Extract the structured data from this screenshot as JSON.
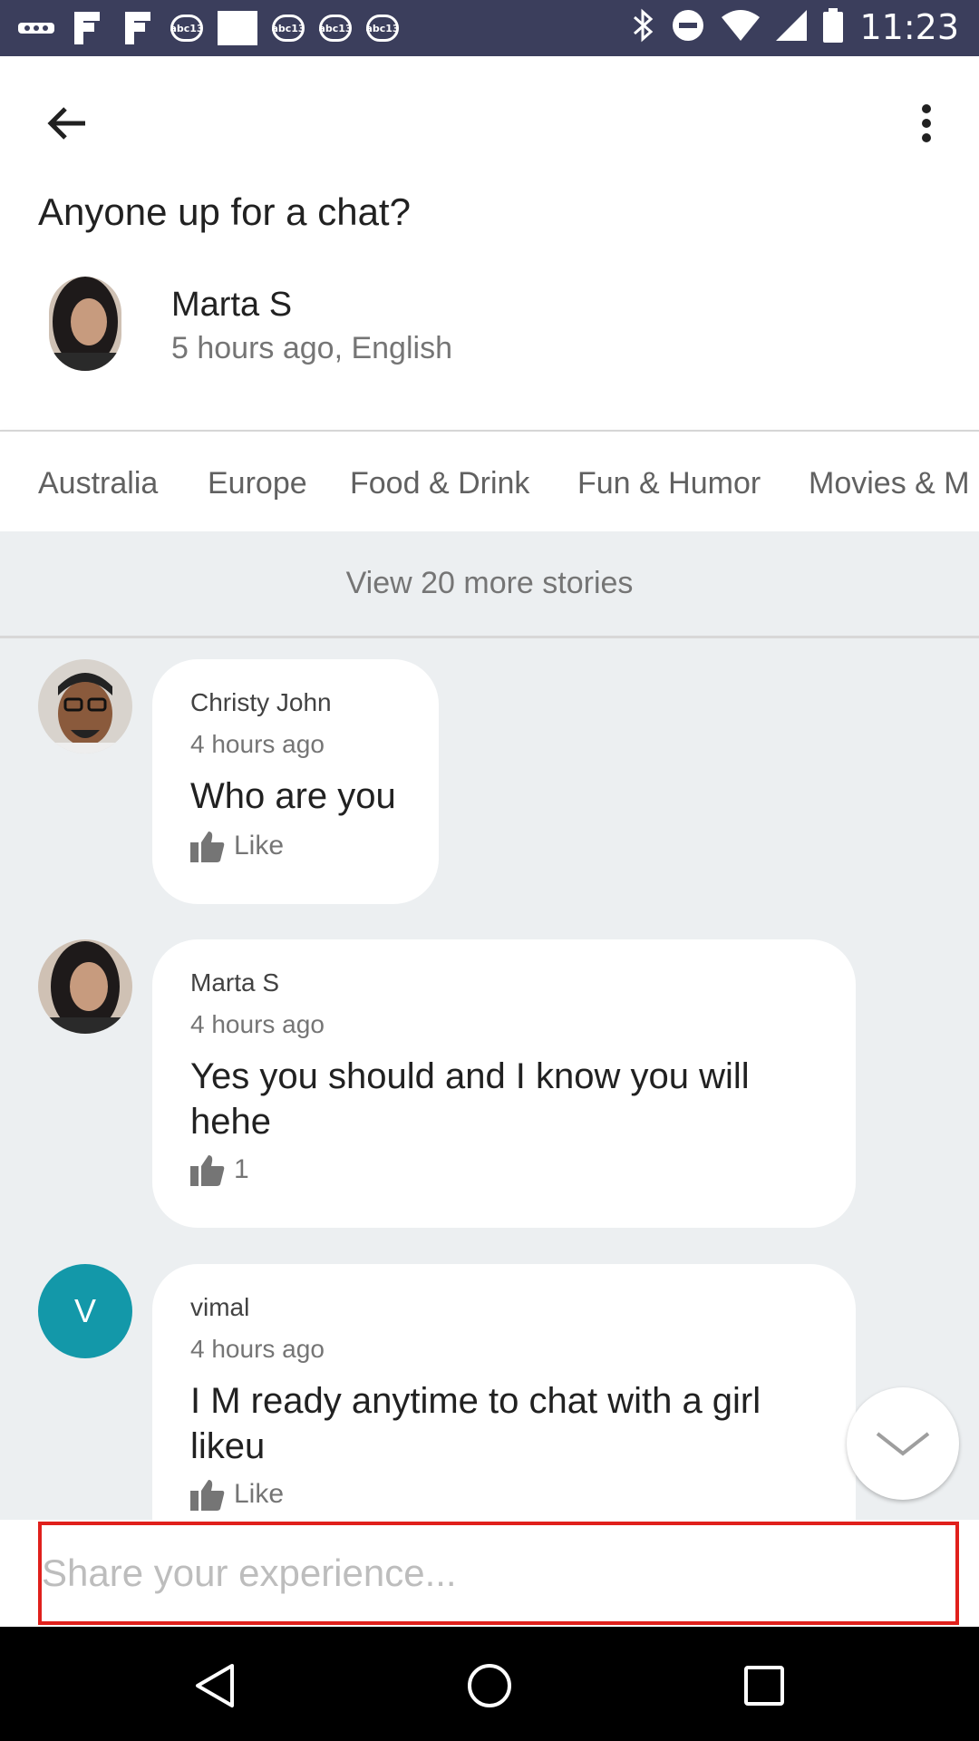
{
  "status_bar": {
    "time": "11:23",
    "notification_icons": [
      "more-icon",
      "flipboard-icon",
      "flipboard-icon",
      "abc13-icon",
      "blank-icon",
      "abc13-icon",
      "abc13-icon",
      "abc13-icon"
    ],
    "badge_text": "abc13",
    "right_icons": [
      "bluetooth-icon",
      "do-not-disturb-icon",
      "wifi-icon",
      "signal-icon",
      "battery-icon"
    ]
  },
  "header": {
    "title": "Anyone up for a chat?",
    "author_name": "Marta S",
    "author_meta": "5 hours ago, English"
  },
  "tabs": [
    "Australia",
    "Europe",
    "Food & Drink",
    "Fun & Humor",
    "Movies & M"
  ],
  "feed": {
    "view_more": "View 20 more stories",
    "comments": [
      {
        "name": "Christy John",
        "time": "4 hours ago",
        "text": "Who are you",
        "like": "Like"
      },
      {
        "name": "Marta S",
        "time": "4 hours ago",
        "text_line1": "Yes you should and I know you will",
        "text_line2": "hehe",
        "like": "1"
      },
      {
        "name": "vimal",
        "avatar_letter": "V",
        "time": "4 hours ago",
        "text_line1": "I M ready anytime to chat with a girl",
        "text_line2": "likeu",
        "like": "Like"
      }
    ]
  },
  "composer": {
    "placeholder": "Share your experience..."
  },
  "colors": {
    "status_bar": "#3b3e5c",
    "feed_bg": "#eceff1",
    "letter_avatar": "#1398a9",
    "input_border": "#e0201c"
  }
}
